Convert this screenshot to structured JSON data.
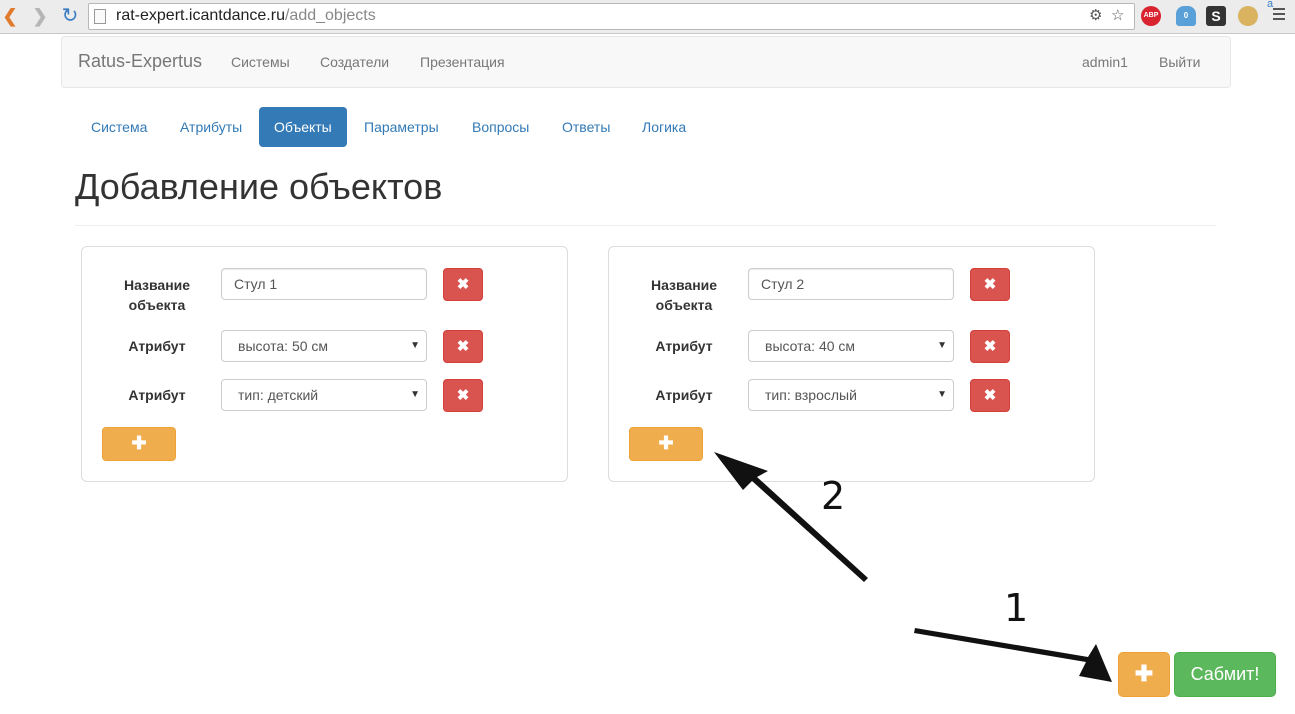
{
  "browser": {
    "url_host": "rat-expert.icantdance.ru",
    "url_path": "/add_objects",
    "extensions": {
      "abp": "ABP",
      "ghost_count": "0",
      "s_icon": "S",
      "a_badge": "a"
    }
  },
  "navbar": {
    "brand": "Ratus-Expertus",
    "links": [
      "Системы",
      "Создатели",
      "Презентация"
    ],
    "user": "admin1",
    "logout": "Выйти"
  },
  "tabs": [
    {
      "label": "Система",
      "active": false
    },
    {
      "label": "Атрибуты",
      "active": false
    },
    {
      "label": "Объекты",
      "active": true
    },
    {
      "label": "Параметры",
      "active": false
    },
    {
      "label": "Вопросы",
      "active": false
    },
    {
      "label": "Ответы",
      "active": false
    },
    {
      "label": "Логика",
      "active": false
    }
  ],
  "page_title": "Добавление объектов",
  "labels": {
    "name_line1": "Название",
    "name_line2": "объекта",
    "attribute": "Атрибут"
  },
  "icons": {
    "delete": "✖",
    "add": "✚"
  },
  "objects": [
    {
      "name": "Стул 1",
      "attributes": [
        "высота: 50 см",
        "тип: детский"
      ]
    },
    {
      "name": "Стул 2",
      "attributes": [
        "высота: 40 см",
        "тип: взрослый"
      ]
    }
  ],
  "actions": {
    "add_object": "✚",
    "submit": "Сабмит!"
  },
  "annotations": {
    "arrow_1": "1",
    "arrow_2": "2"
  },
  "colors": {
    "primary": "#337ab7",
    "danger": "#d9534f",
    "warning": "#f0ad4e",
    "success": "#5cb85c"
  }
}
